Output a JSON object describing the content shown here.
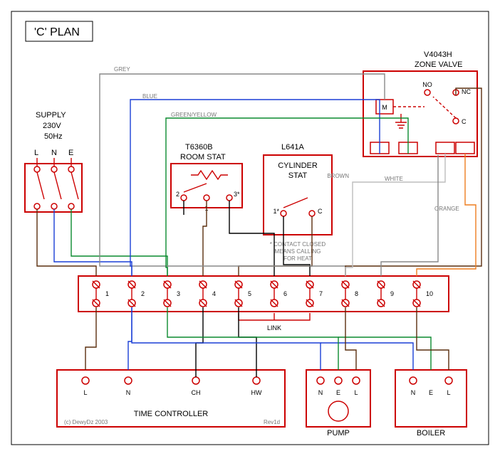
{
  "title": "'C' PLAN",
  "supply": {
    "label": "SUPPLY",
    "voltage": "230V",
    "freq": "50Hz",
    "L": "L",
    "N": "N",
    "E": "E"
  },
  "roomstat": {
    "model": "T6360B",
    "label": "ROOM STAT",
    "t1": "2",
    "t2": "1",
    "t3": "3*"
  },
  "cylstat": {
    "model": "L641A",
    "label1": "CYLINDER",
    "label2": "STAT",
    "t1": "1*",
    "t2": "C",
    "note1": "* CONTACT CLOSED",
    "note2": "MEANS CALLING",
    "note3": "FOR HEAT"
  },
  "zone": {
    "model": "V4043H",
    "label": "ZONE VALVE",
    "M": "M",
    "NO": "NO",
    "NC": "NC",
    "C": "C"
  },
  "junction": {
    "t1": "1",
    "t2": "2",
    "t3": "3",
    "t4": "4",
    "t5": "5",
    "t6": "6",
    "t7": "7",
    "t8": "8",
    "t9": "9",
    "t10": "10",
    "link": "LINK"
  },
  "tc": {
    "label": "TIME CONTROLLER",
    "L": "L",
    "N": "N",
    "CH": "CH",
    "HW": "HW"
  },
  "pump": {
    "label": "PUMP",
    "N": "N",
    "E": "E",
    "L": "L"
  },
  "boiler": {
    "label": "BOILER",
    "N": "N",
    "E": "E",
    "L": "L"
  },
  "wires": {
    "grey": "GREY",
    "blue": "BLUE",
    "green": "GREEN/YELLOW",
    "brown": "BROWN",
    "white": "WHITE",
    "orange": "ORANGE"
  },
  "credit": "(c) DewyDz 2003",
  "rev": "Rev1d"
}
